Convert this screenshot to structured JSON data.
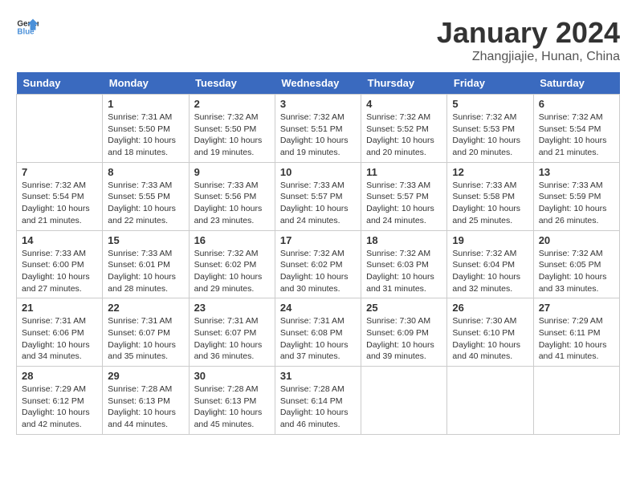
{
  "logo": {
    "line1": "General",
    "line2": "Blue"
  },
  "title": "January 2024",
  "location": "Zhangjiajie, Hunan, China",
  "days_of_week": [
    "Sunday",
    "Monday",
    "Tuesday",
    "Wednesday",
    "Thursday",
    "Friday",
    "Saturday"
  ],
  "weeks": [
    [
      {
        "day": "",
        "info": ""
      },
      {
        "day": "1",
        "info": "Sunrise: 7:31 AM\nSunset: 5:50 PM\nDaylight: 10 hours\nand 18 minutes."
      },
      {
        "day": "2",
        "info": "Sunrise: 7:32 AM\nSunset: 5:50 PM\nDaylight: 10 hours\nand 19 minutes."
      },
      {
        "day": "3",
        "info": "Sunrise: 7:32 AM\nSunset: 5:51 PM\nDaylight: 10 hours\nand 19 minutes."
      },
      {
        "day": "4",
        "info": "Sunrise: 7:32 AM\nSunset: 5:52 PM\nDaylight: 10 hours\nand 20 minutes."
      },
      {
        "day": "5",
        "info": "Sunrise: 7:32 AM\nSunset: 5:53 PM\nDaylight: 10 hours\nand 20 minutes."
      },
      {
        "day": "6",
        "info": "Sunrise: 7:32 AM\nSunset: 5:54 PM\nDaylight: 10 hours\nand 21 minutes."
      }
    ],
    [
      {
        "day": "7",
        "info": "Sunrise: 7:32 AM\nSunset: 5:54 PM\nDaylight: 10 hours\nand 21 minutes."
      },
      {
        "day": "8",
        "info": "Sunrise: 7:33 AM\nSunset: 5:55 PM\nDaylight: 10 hours\nand 22 minutes."
      },
      {
        "day": "9",
        "info": "Sunrise: 7:33 AM\nSunset: 5:56 PM\nDaylight: 10 hours\nand 23 minutes."
      },
      {
        "day": "10",
        "info": "Sunrise: 7:33 AM\nSunset: 5:57 PM\nDaylight: 10 hours\nand 24 minutes."
      },
      {
        "day": "11",
        "info": "Sunrise: 7:33 AM\nSunset: 5:57 PM\nDaylight: 10 hours\nand 24 minutes."
      },
      {
        "day": "12",
        "info": "Sunrise: 7:33 AM\nSunset: 5:58 PM\nDaylight: 10 hours\nand 25 minutes."
      },
      {
        "day": "13",
        "info": "Sunrise: 7:33 AM\nSunset: 5:59 PM\nDaylight: 10 hours\nand 26 minutes."
      }
    ],
    [
      {
        "day": "14",
        "info": "Sunrise: 7:33 AM\nSunset: 6:00 PM\nDaylight: 10 hours\nand 27 minutes."
      },
      {
        "day": "15",
        "info": "Sunrise: 7:33 AM\nSunset: 6:01 PM\nDaylight: 10 hours\nand 28 minutes."
      },
      {
        "day": "16",
        "info": "Sunrise: 7:32 AM\nSunset: 6:02 PM\nDaylight: 10 hours\nand 29 minutes."
      },
      {
        "day": "17",
        "info": "Sunrise: 7:32 AM\nSunset: 6:02 PM\nDaylight: 10 hours\nand 30 minutes."
      },
      {
        "day": "18",
        "info": "Sunrise: 7:32 AM\nSunset: 6:03 PM\nDaylight: 10 hours\nand 31 minutes."
      },
      {
        "day": "19",
        "info": "Sunrise: 7:32 AM\nSunset: 6:04 PM\nDaylight: 10 hours\nand 32 minutes."
      },
      {
        "day": "20",
        "info": "Sunrise: 7:32 AM\nSunset: 6:05 PM\nDaylight: 10 hours\nand 33 minutes."
      }
    ],
    [
      {
        "day": "21",
        "info": "Sunrise: 7:31 AM\nSunset: 6:06 PM\nDaylight: 10 hours\nand 34 minutes."
      },
      {
        "day": "22",
        "info": "Sunrise: 7:31 AM\nSunset: 6:07 PM\nDaylight: 10 hours\nand 35 minutes."
      },
      {
        "day": "23",
        "info": "Sunrise: 7:31 AM\nSunset: 6:07 PM\nDaylight: 10 hours\nand 36 minutes."
      },
      {
        "day": "24",
        "info": "Sunrise: 7:31 AM\nSunset: 6:08 PM\nDaylight: 10 hours\nand 37 minutes."
      },
      {
        "day": "25",
        "info": "Sunrise: 7:30 AM\nSunset: 6:09 PM\nDaylight: 10 hours\nand 39 minutes."
      },
      {
        "day": "26",
        "info": "Sunrise: 7:30 AM\nSunset: 6:10 PM\nDaylight: 10 hours\nand 40 minutes."
      },
      {
        "day": "27",
        "info": "Sunrise: 7:29 AM\nSunset: 6:11 PM\nDaylight: 10 hours\nand 41 minutes."
      }
    ],
    [
      {
        "day": "28",
        "info": "Sunrise: 7:29 AM\nSunset: 6:12 PM\nDaylight: 10 hours\nand 42 minutes."
      },
      {
        "day": "29",
        "info": "Sunrise: 7:28 AM\nSunset: 6:13 PM\nDaylight: 10 hours\nand 44 minutes."
      },
      {
        "day": "30",
        "info": "Sunrise: 7:28 AM\nSunset: 6:13 PM\nDaylight: 10 hours\nand 45 minutes."
      },
      {
        "day": "31",
        "info": "Sunrise: 7:28 AM\nSunset: 6:14 PM\nDaylight: 10 hours\nand 46 minutes."
      },
      {
        "day": "",
        "info": ""
      },
      {
        "day": "",
        "info": ""
      },
      {
        "day": "",
        "info": ""
      }
    ]
  ]
}
